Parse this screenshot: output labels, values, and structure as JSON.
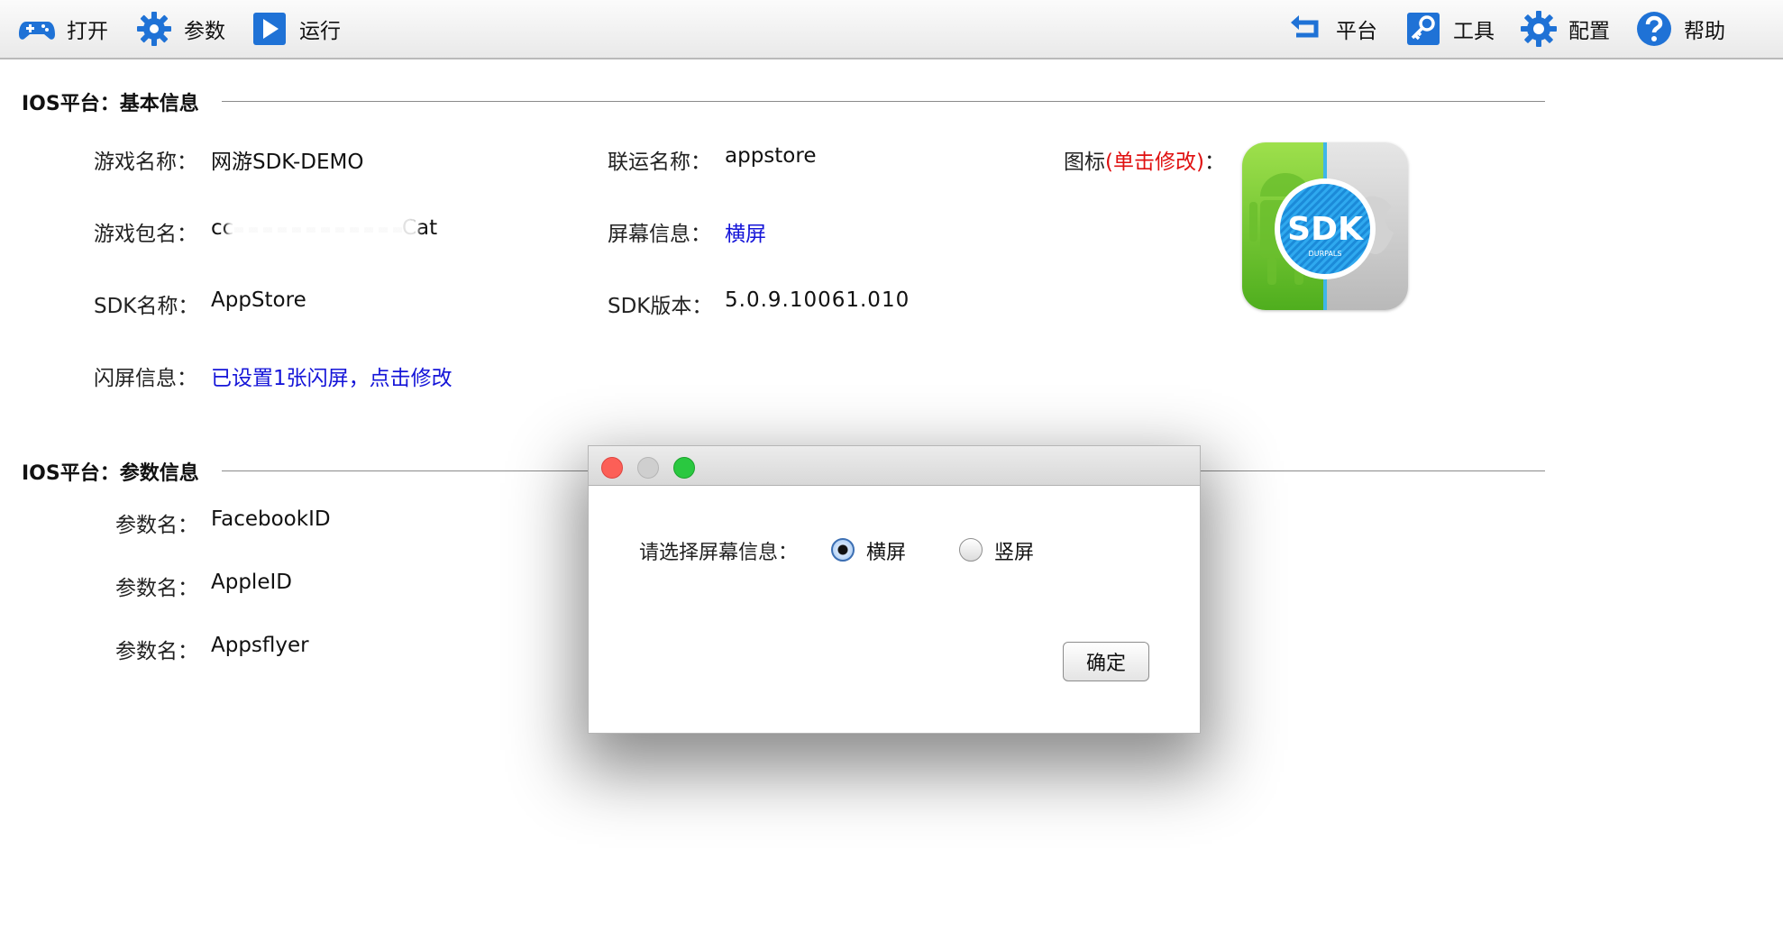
{
  "toolbar": {
    "left": [
      {
        "label": "打开",
        "icon": "gamepad-icon"
      },
      {
        "label": "参数",
        "icon": "gear-icon"
      },
      {
        "label": "运行",
        "icon": "play-icon"
      }
    ],
    "right": [
      {
        "label": "平台",
        "icon": "switch-icon"
      },
      {
        "label": "工具",
        "icon": "key-icon"
      },
      {
        "label": "配置",
        "icon": "settings-icon"
      },
      {
        "label": "帮助",
        "icon": "help-icon"
      }
    ]
  },
  "basic_section": {
    "title": "IOS平台：基本信息",
    "game_name": {
      "label": "游戏名称：",
      "value": "网游SDK-DEMO"
    },
    "channel_name": {
      "label": "联运名称：",
      "value": "appstore"
    },
    "icon_label": {
      "prefix": "图标",
      "hint": "(单击修改)",
      "suffix": "："
    },
    "package_name": {
      "label": "游戏包名：",
      "value_start": "cc",
      "value_end": "Cat"
    },
    "screen_info": {
      "label": "屏幕信息：",
      "value": "横屏"
    },
    "sdk_name": {
      "label": "SDK名称：",
      "value": "AppStore"
    },
    "sdk_version": {
      "label": "SDK版本：",
      "value": "5.0.9.10061.010"
    },
    "splash_info": {
      "label": "闪屏信息：",
      "value": "已设置1张闪屏，点击修改"
    },
    "app_icon": {
      "badge_text": "SDK",
      "sub_text": "DURPALS"
    }
  },
  "param_section": {
    "title": "IOS平台：参数信息",
    "params": [
      {
        "label": "参数名：",
        "value": "FacebookID"
      },
      {
        "label": "参数名：",
        "value": "AppleID"
      },
      {
        "label": "参数名：",
        "value": "Appsflyer"
      }
    ]
  },
  "dialog": {
    "prompt": "请选择屏幕信息：",
    "options": [
      {
        "label": "横屏",
        "selected": true
      },
      {
        "label": "竖屏",
        "selected": false
      }
    ],
    "ok_label": "确定"
  },
  "colors": {
    "link": "#1515d8",
    "hint_red": "#e01010",
    "icon_blue": "#1f72d6"
  }
}
